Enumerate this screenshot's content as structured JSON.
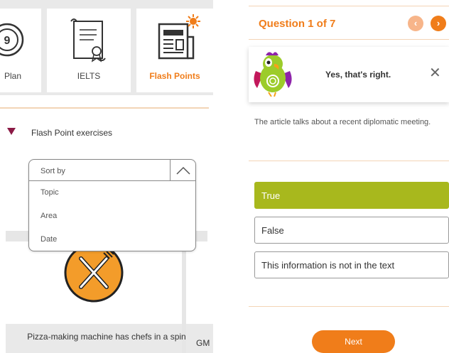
{
  "tiles": [
    {
      "label": "Plan",
      "icon": "plan-icon"
    },
    {
      "label": "IELTS",
      "icon": "certificate-icon"
    },
    {
      "label": "Flash Points",
      "icon": "newspaper-icon"
    }
  ],
  "section": {
    "heading": "Flash Point exercises"
  },
  "sort": {
    "label": "Sort by",
    "options": [
      "Topic",
      "Area",
      "Date"
    ]
  },
  "cards": [
    {
      "title": "Pizza-making machine has chefs in a spin",
      "icon": "knife-fork-icon"
    },
    {
      "title": "GM"
    }
  ],
  "quiz": {
    "header": "Question 1 of 7",
    "prev_icon": "chevron-left-icon",
    "next_icon": "chevron-right-icon",
    "feedback": "Yes, that's right.",
    "statement": "The article talks about a recent diplomatic meeting.",
    "options": [
      "True",
      "False",
      "This information is not in the text"
    ],
    "selected_index": 0,
    "next_label": "Next"
  },
  "colors": {
    "accent": "#f07d1a",
    "correct": "#a8b81d",
    "caret": "#8b1a45"
  }
}
